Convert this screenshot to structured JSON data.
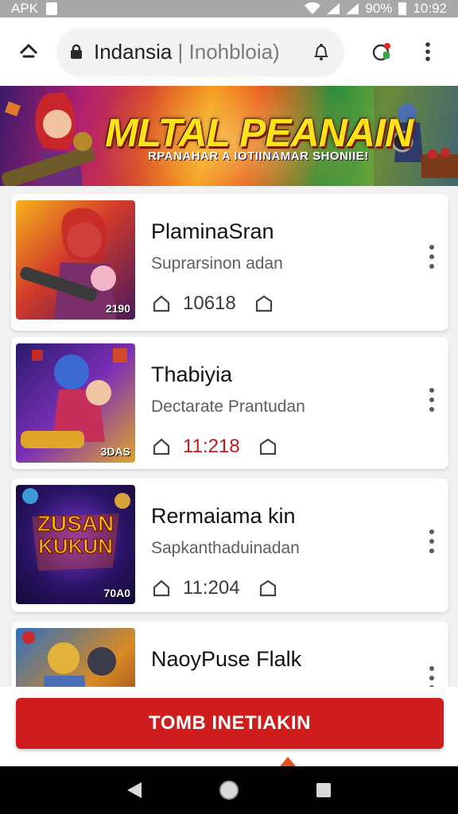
{
  "status_bar": {
    "app_label": "APK",
    "battery": "90%",
    "time": "10:92"
  },
  "browser": {
    "url_main": "Indansia",
    "url_secondary": "| Inohbloia)"
  },
  "banner": {
    "title": "MLTAL PEANAIN",
    "subtitle": "RPANAHAR A IOTIINAMAR SHONIIE!"
  },
  "items": [
    {
      "title": "PlaminaSran",
      "subtitle": "Suprarsinon adan",
      "stat": "10618",
      "stat_color": "#3a3a3a",
      "thumb_tag": "2190",
      "thumb_colors": [
        "#f2a51b",
        "#c32c2c",
        "#5b1f63"
      ]
    },
    {
      "title": "Thabiyia",
      "subtitle": "Dectarate Prantudan",
      "stat": "11:218",
      "stat_color": "#c4161c",
      "thumb_tag": "3DAS",
      "thumb_colors": [
        "#2a1b6e",
        "#b02fc9",
        "#e0a52a"
      ]
    },
    {
      "title": "Rermaiama kin",
      "subtitle": "Sapkanthaduinadan",
      "stat": "11:204",
      "stat_color": "#3a3a3a",
      "thumb_tag": "70A0",
      "thumb_colors": [
        "#19124d",
        "#6d2bb8",
        "#f3b61f"
      ]
    },
    {
      "title": "NaoyPuse Flalk",
      "subtitle": "",
      "stat": "",
      "stat_color": "#3a3a3a",
      "thumb_tag": "",
      "thumb_colors": [
        "#2f6fbd",
        "#d98a23",
        "#7e2a1f"
      ]
    }
  ],
  "cta": {
    "label": "TOMB INETIAKIN"
  },
  "icons": {
    "home": "home-icon",
    "lock": "lock-icon",
    "url_action": "bell-outline-icon",
    "extension": "extension-icon",
    "menu": "more-vert-icon",
    "star": "star-outline-icon",
    "share": "home-outline-icon",
    "back": "back-triangle-icon",
    "home_nav": "circle-home-icon",
    "recents": "square-recents-icon"
  },
  "colors": {
    "accent": "#cf1d1d",
    "banner_title": "#ffe31a"
  }
}
